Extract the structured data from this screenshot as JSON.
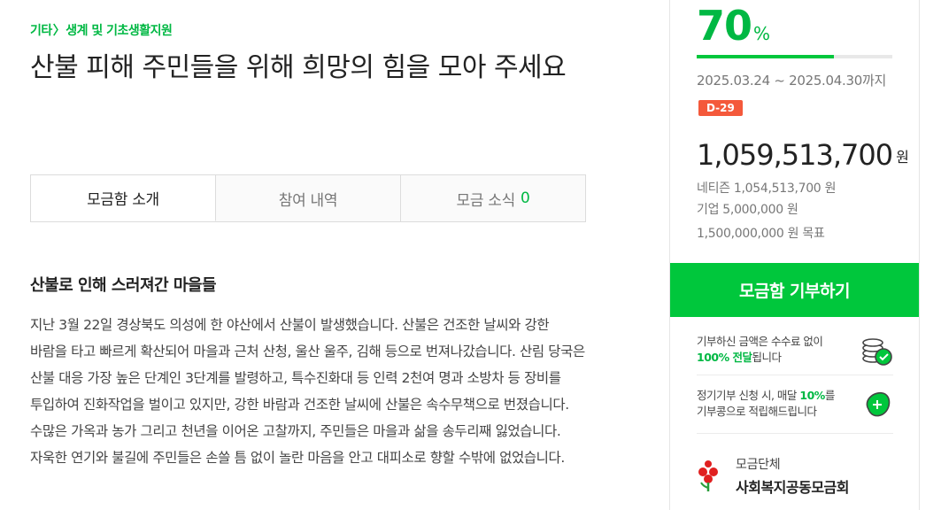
{
  "breadcrumb": {
    "parent": "기타",
    "separator": "〉",
    "child": "생계 및 기초생활지원"
  },
  "title": "산불 피해 주민들을 위해 희망의 힘을 모아 주세요",
  "tabs": [
    {
      "label": "모금함 소개",
      "active": true
    },
    {
      "label": "참여 내역",
      "active": false
    },
    {
      "label": "모금 소식",
      "count": "0",
      "active": false
    }
  ],
  "content": {
    "heading": "산불로 인해 스러져간 마을들",
    "paragraph": "지난 3월 22일 경상북도 의성에 한 야산에서 산불이 발생했습니다. 산불은 건조한 날씨와 강한 바람을 타고 빠르게 확산되어 마을과 근처 산청, 울산 울주, 김해 등으로 번져나갔습니다. 산림 당국은 산불 대응 가장 높은 단계인 3단계를 발령하고, 특수진화대 등 인력 2천여 명과 소방차 등 장비를 투입하여 진화작업을 벌이고 있지만, 강한 바람과 건조한 날씨에 산불은 속수무책으로 번졌습니다. 수많은 가옥과 농가 그리고 천년을 이어온 고찰까지, 주민들은 마을과 삶을 송두리째 잃었습니다. 자욱한 연기와 불길에 주민들은 손쓸 틈 없이 놀란 마음을 안고 대피소로 향할 수밖에 없었습니다."
  },
  "sidebar": {
    "progress_percent": "70",
    "progress_unit": "%",
    "progress_fraction": 0.7,
    "period": "2025.03.24 ~ 2025.04.30까지",
    "dday": "D-29",
    "total_amount": "1,059,513,700",
    "total_unit": "원",
    "netizen": "네티즌 1,054,513,700 원",
    "company": "기업 5,000,000 원",
    "goal": "1,500,000,000 원 목표",
    "donate_button": "모금함 기부하기",
    "info1_pre": "기부하신 금액은 수수료 없이",
    "info1_hl": "100% 전달",
    "info1_post": "됩니다",
    "info2_pre": "정기기부 신청 시, 매달",
    "info2_hl": "10%",
    "info2_mid": "를",
    "info2_post": "기부콩으로 적립해드립니다",
    "org_label": "모금단체",
    "org_name": "사회복지공동모금회",
    "colors": {
      "accent": "#00c73c",
      "accent_text": "#00b843",
      "dday_bg": "#f4593b"
    }
  }
}
